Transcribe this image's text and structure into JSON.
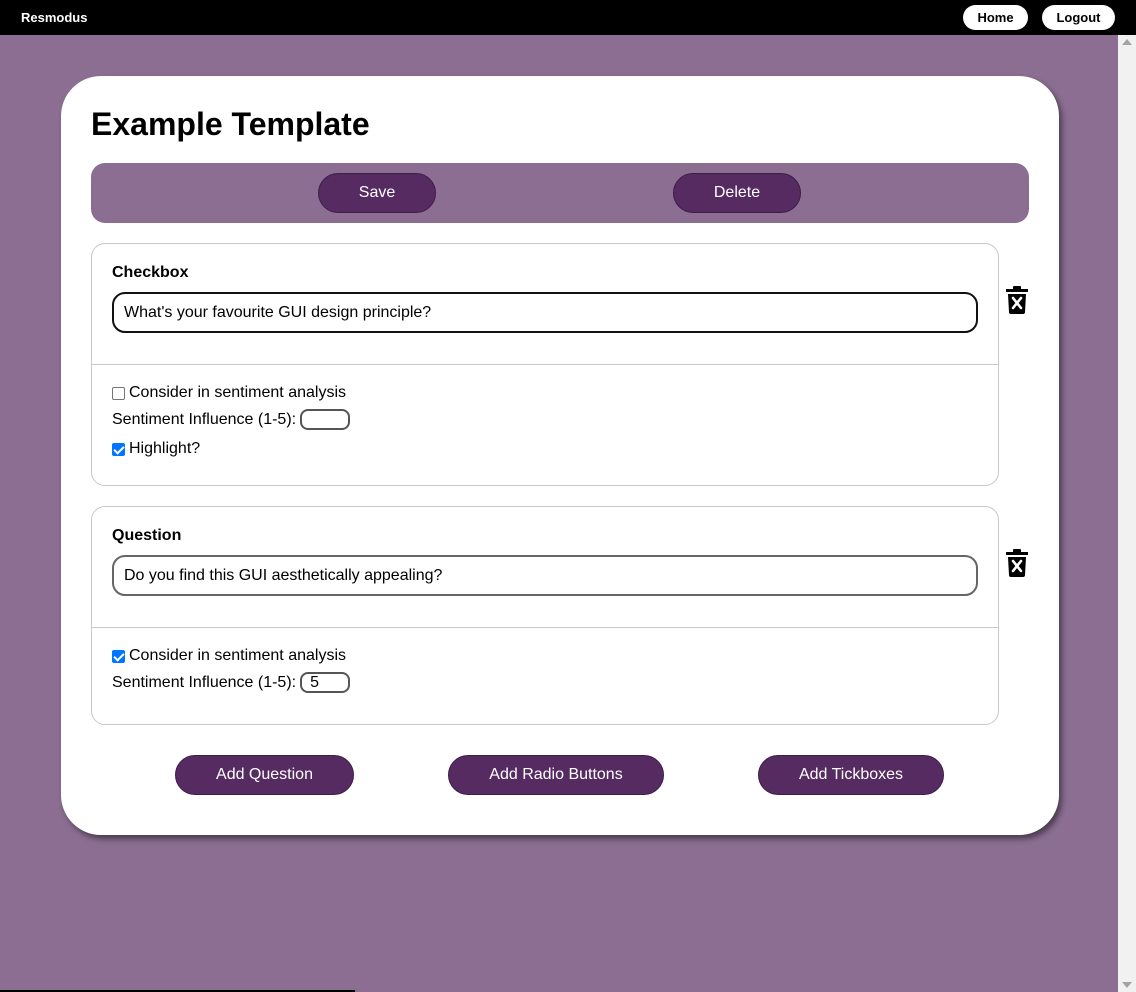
{
  "nav": {
    "brand": "Resmodus",
    "home_label": "Home",
    "logout_label": "Logout"
  },
  "page": {
    "title": "Example Template"
  },
  "toolbar": {
    "save_label": "Save",
    "delete_label": "Delete"
  },
  "questions": [
    {
      "type_label": "Checkbox",
      "text": "What's your favourite GUI design principle?",
      "consider_label": "Consider in sentiment analysis",
      "consider_checked": false,
      "influence_label": "Sentiment Influence (1-5):",
      "influence_value": "",
      "highlight_label": "Highlight?",
      "highlight_checked": true,
      "delete_icon": "trash-x-icon"
    },
    {
      "type_label": "Question",
      "text": "Do you find this GUI aesthetically appealing?",
      "consider_label": "Consider in sentiment analysis",
      "consider_checked": true,
      "influence_label": "Sentiment Influence (1-5):",
      "influence_value": "5",
      "delete_icon": "trash-x-icon"
    }
  ],
  "actions": {
    "add_question_label": "Add Question",
    "add_radio_label": "Add Radio Buttons",
    "add_tickboxes_label": "Add Tickboxes"
  },
  "colors": {
    "background": "#8b6e92",
    "accent": "#562b62",
    "topbar": "#000000",
    "checkbox": "#0075ff"
  }
}
